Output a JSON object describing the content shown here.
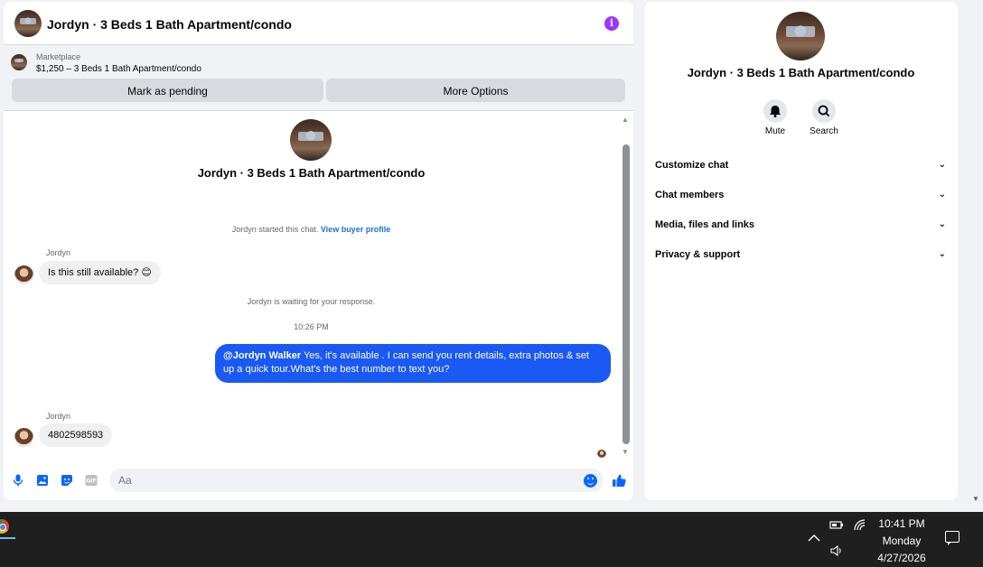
{
  "header": {
    "title": "Jordyn · 3 Beds 1 Bath Apartment/condo"
  },
  "marketplace": {
    "label": "Marketplace",
    "listing": "$1,250 – 3 Beds 1 Bath Apartment/condo",
    "mark_pending_label": "Mark as pending",
    "more_options_label": "More Options"
  },
  "conversation": {
    "title": "Jordyn · 3 Beds 1 Bath Apartment/condo",
    "started_text": "Jordyn started this chat.",
    "view_profile_link": "View buyer profile",
    "waiting_text": "Jordyn is waiting for your response.",
    "timestamp": "10:26 PM",
    "messages": [
      {
        "sender": "Jordyn",
        "text": "Is this still available? 😊"
      },
      {
        "mention": "@Jordyn Walker",
        "text": " Yes, it's available .  I can send you rent details, extra photos & set up a quick tour.What's the best number to text you?"
      },
      {
        "sender": "Jordyn",
        "text": "4802598593"
      }
    ]
  },
  "composer": {
    "placeholder": "Aa"
  },
  "info_panel": {
    "title": "Jordyn · 3 Beds 1 Bath Apartment/condo",
    "mute_label": "Mute",
    "search_label": "Search",
    "sections": [
      "Customize chat",
      "Chat members",
      "Media, files and links",
      "Privacy & support"
    ]
  },
  "taskbar": {
    "time": "10:41 PM",
    "day": "Monday",
    "date": "4/27/2026"
  },
  "colors": {
    "accent": "#0866ff",
    "outgoing_bubble": "#1b59f5",
    "info_icon": "#a033ff"
  }
}
